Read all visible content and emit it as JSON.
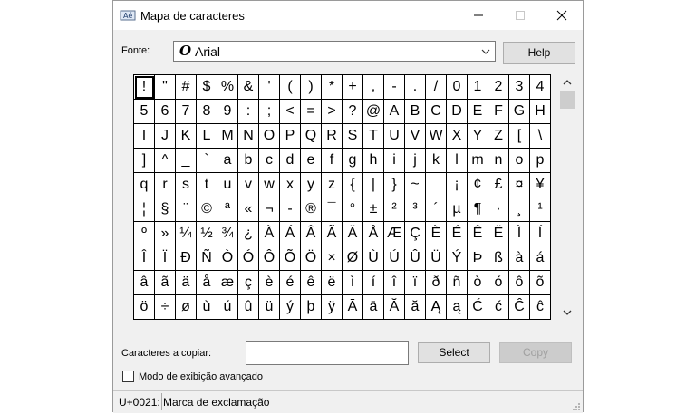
{
  "window": {
    "title": "Mapa de caracteres",
    "accent_color": "#000000"
  },
  "font": {
    "label": "Fonte:",
    "selected": "Arial",
    "glyph": "O",
    "help_label": "Help"
  },
  "grid": {
    "selected_index": 0,
    "rows": [
      [
        "!",
        "\"",
        "#",
        "$",
        "%",
        "&",
        "'",
        "(",
        ")",
        "*",
        "+",
        ",",
        "-",
        ".",
        "/",
        "0",
        "1",
        "2",
        "3",
        "4"
      ],
      [
        "5",
        "6",
        "7",
        "8",
        "9",
        ":",
        ";",
        "<",
        "=",
        ">",
        "?",
        "@",
        "A",
        "B",
        "C",
        "D",
        "E",
        "F",
        "G",
        "H"
      ],
      [
        "I",
        "J",
        "K",
        "L",
        "M",
        "N",
        "O",
        "P",
        "Q",
        "R",
        "S",
        "T",
        "U",
        "V",
        "W",
        "X",
        "Y",
        "Z",
        "[",
        "\\"
      ],
      [
        "]",
        "^",
        "_",
        "`",
        "a",
        "b",
        "c",
        "d",
        "e",
        "f",
        "g",
        "h",
        "i",
        "j",
        "k",
        "l",
        "m",
        "n",
        "o",
        "p"
      ],
      [
        "q",
        "r",
        "s",
        "t",
        "u",
        "v",
        "w",
        "x",
        "y",
        "z",
        "{",
        "|",
        "}",
        "~",
        " ",
        "¡",
        "¢",
        "£",
        "¤",
        "¥"
      ],
      [
        "¦",
        "§",
        "¨",
        "©",
        "ª",
        "«",
        "¬",
        "-",
        "®",
        "¯",
        "°",
        "±",
        "²",
        "³",
        "´",
        "µ",
        "¶",
        "·",
        "¸",
        "¹"
      ],
      [
        "º",
        "»",
        "¼",
        "½",
        "¾",
        "¿",
        "À",
        "Á",
        "Â",
        "Ã",
        "Ä",
        "Å",
        "Æ",
        "Ç",
        "È",
        "É",
        "Ê",
        "Ë",
        "Ì",
        "Í"
      ],
      [
        "Î",
        "Ï",
        "Ð",
        "Ñ",
        "Ò",
        "Ó",
        "Ô",
        "Õ",
        "Ö",
        "×",
        "Ø",
        "Ù",
        "Ú",
        "Û",
        "Ü",
        "Ý",
        "Þ",
        "ß",
        "à",
        "á"
      ],
      [
        "â",
        "ã",
        "ä",
        "å",
        "æ",
        "ç",
        "è",
        "é",
        "ê",
        "ë",
        "ì",
        "í",
        "î",
        "ï",
        "ð",
        "ñ",
        "ò",
        "ó",
        "ô",
        "õ"
      ],
      [
        "ö",
        "÷",
        "ø",
        "ù",
        "ú",
        "û",
        "ü",
        "ý",
        "þ",
        "ÿ",
        "Ā",
        "ā",
        "Ă",
        "ă",
        "Ą",
        "ą",
        "Ć",
        "ć",
        "Ĉ",
        "ĉ"
      ]
    ]
  },
  "copy": {
    "label": "Caracteres a copiar:",
    "value": "",
    "select_label": "Select",
    "copy_label": "Copy"
  },
  "advanced": {
    "label": "Modo de exibição avançado",
    "checked": false
  },
  "status": {
    "code": "U+0021",
    "description": "Marca de exclamação"
  }
}
